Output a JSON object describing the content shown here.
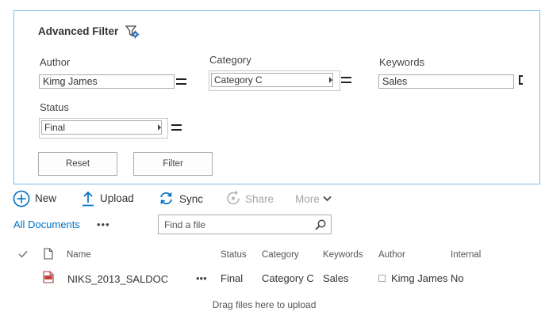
{
  "filter": {
    "title": "Advanced Filter",
    "fields": {
      "author": {
        "label": "Author",
        "value": "Kimg James"
      },
      "category": {
        "label": "Category",
        "value": "Category C"
      },
      "keywords": {
        "label": "Keywords",
        "value": "Sales"
      },
      "status": {
        "label": "Status",
        "value": "Final"
      }
    },
    "buttons": {
      "reset": "Reset",
      "filter": "Filter"
    }
  },
  "commands": {
    "new": "New",
    "upload": "Upload",
    "sync": "Sync",
    "share": "Share",
    "more": "More"
  },
  "view": {
    "name": "All Documents",
    "more": "•••",
    "search_placeholder": "Find a file"
  },
  "table": {
    "columns": [
      "Name",
      "Status",
      "Category",
      "Keywords",
      "Author",
      "Internal"
    ],
    "rows": [
      {
        "name": "NIKS_2013_SALDOC",
        "actions": "•••",
        "status": "Final",
        "category": "Category C",
        "keywords": "Sales",
        "author": "Kimg James",
        "internal": "No"
      }
    ]
  },
  "drag_hint": "Drag files here to upload",
  "colors": {
    "accent": "#0072c6",
    "panel_border": "#7fbce6",
    "disabled": "#a6a6a6"
  }
}
